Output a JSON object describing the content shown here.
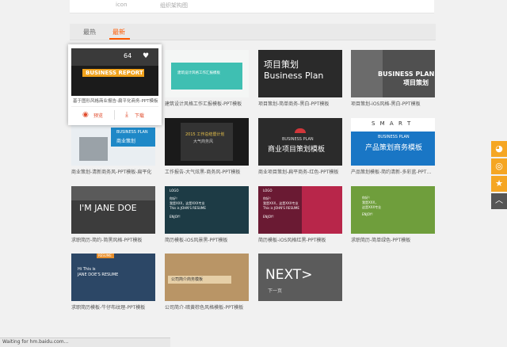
{
  "top": {
    "label1": "icon",
    "label2": "组织架构图"
  },
  "tabs": [
    {
      "label": "最热"
    },
    {
      "label": "最新"
    }
  ],
  "popup": {
    "caption": "基于图形风格商业报告-扁平化商务-PPT模板",
    "preview_label": "预览",
    "download_label": "下载",
    "thumb_title": "BUSINESS REPORT",
    "count": "64"
  },
  "cards": [
    {
      "caption": "基于图形风格商业报告-扁平化商务-PPT模板"
    },
    {
      "caption": "建筑设计风格工作汇报模板-PPT模板",
      "thumb_text": "建筑设计风格工作汇报模板"
    },
    {
      "caption": "项目策划-简单商务-黑白-PPT模板",
      "thumb_title": "项目策划",
      "thumb_sub": "Business Plan"
    },
    {
      "caption": "项目策划-iOS风格-黑白-PPT模板",
      "thumb_title": "BUSINESS PLAN",
      "thumb_sub": "项目策划"
    },
    {
      "caption": "商业策划-清新商务风-PPT模板-扁平化",
      "thumb_title": "BUSINESS PLAN",
      "thumb_sub": "商业策划"
    },
    {
      "caption": "工作报告-大气炫黑-商务风-PPT模板",
      "thumb_title": "2015 工作总结暨计划",
      "thumb_sub": "大气商务风"
    },
    {
      "caption": "商业项目策划-扁平商务-红色-PPT模板",
      "thumb_title": "BUSINESS PLAN",
      "thumb_sub": "商业项目策划模板"
    },
    {
      "caption": "产品策划模板-简约清新-多彩蓝-PPT模板",
      "thumb_title": "S M A R T",
      "thumb_sub": "BUSINESS PLAN",
      "thumb_sub2": "产品策划商务模板"
    },
    {
      "caption": "求职简历-简约-简黑风格-PPT模板",
      "thumb_title": "I'M JANE DOE"
    },
    {
      "caption": "简历模板-iOS风景黑-PPT模板",
      "thumb_logo": "LOGO",
      "thumb_lines": [
        "你好！",
        "我是XXX，这是XXX专业",
        "This is JOHN'S RESUME",
        "ENJOY!"
      ]
    },
    {
      "caption": "简历模板-iOS风格红黑-PPT模板",
      "thumb_logo": "LOGO",
      "thumb_lines": [
        "你好！",
        "我是XXX，这是XXX专业",
        "This is JOHN'S RESUME",
        "ENJOY!"
      ]
    },
    {
      "caption": "求职简历-简单绿色-PPT模板",
      "thumb_lines": [
        "你好！",
        "我是XXX，",
        "这是XXX专业",
        "ENJOY!"
      ]
    },
    {
      "caption": "求职简历模板-牛仔布纹理-PPT模板",
      "thumb_title": "RESUME",
      "thumb_lines": [
        "Hi This is",
        "JANE DOE'S RESUME"
      ]
    },
    {
      "caption": "公司简介-暗黄棕色风格模板-PPT模板",
      "thumb_title": "公司简介商务模板"
    }
  ],
  "next": {
    "label": "NEXT>",
    "sub": "下一页"
  },
  "status": {
    "text": "Waiting for hm.baidu.com..."
  },
  "side_icons": [
    "wechat-icon",
    "weibo-icon",
    "star-icon",
    "scroll-top-icon"
  ],
  "colors": {
    "accent": "#ff5a00",
    "side_orange": "#f5a623"
  }
}
